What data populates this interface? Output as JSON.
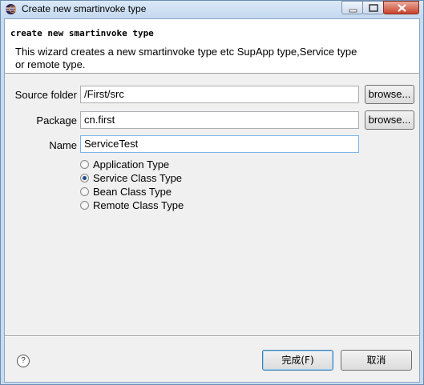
{
  "window": {
    "title": "Create new smartinvoke type"
  },
  "banner": {
    "heading": "create new smartinvoke type",
    "description": "This wizard creates a new smartinvoke type etc SupApp type,Service type or remote type."
  },
  "form": {
    "source_folder": {
      "label": "Source folder",
      "value": "/First/src",
      "button": "browse..."
    },
    "package": {
      "label": "Package",
      "value": "cn.first",
      "button": "browse..."
    },
    "name": {
      "label": "Name",
      "value": "ServiceTest"
    },
    "types": [
      {
        "label": "Application Type",
        "checked": false
      },
      {
        "label": "Service Class Type",
        "checked": true
      },
      {
        "label": "Bean Class Type",
        "checked": false
      },
      {
        "label": "Remote Class Type",
        "checked": false
      }
    ]
  },
  "footer": {
    "help": "?",
    "finish": "完成(F)",
    "cancel": "取消"
  }
}
